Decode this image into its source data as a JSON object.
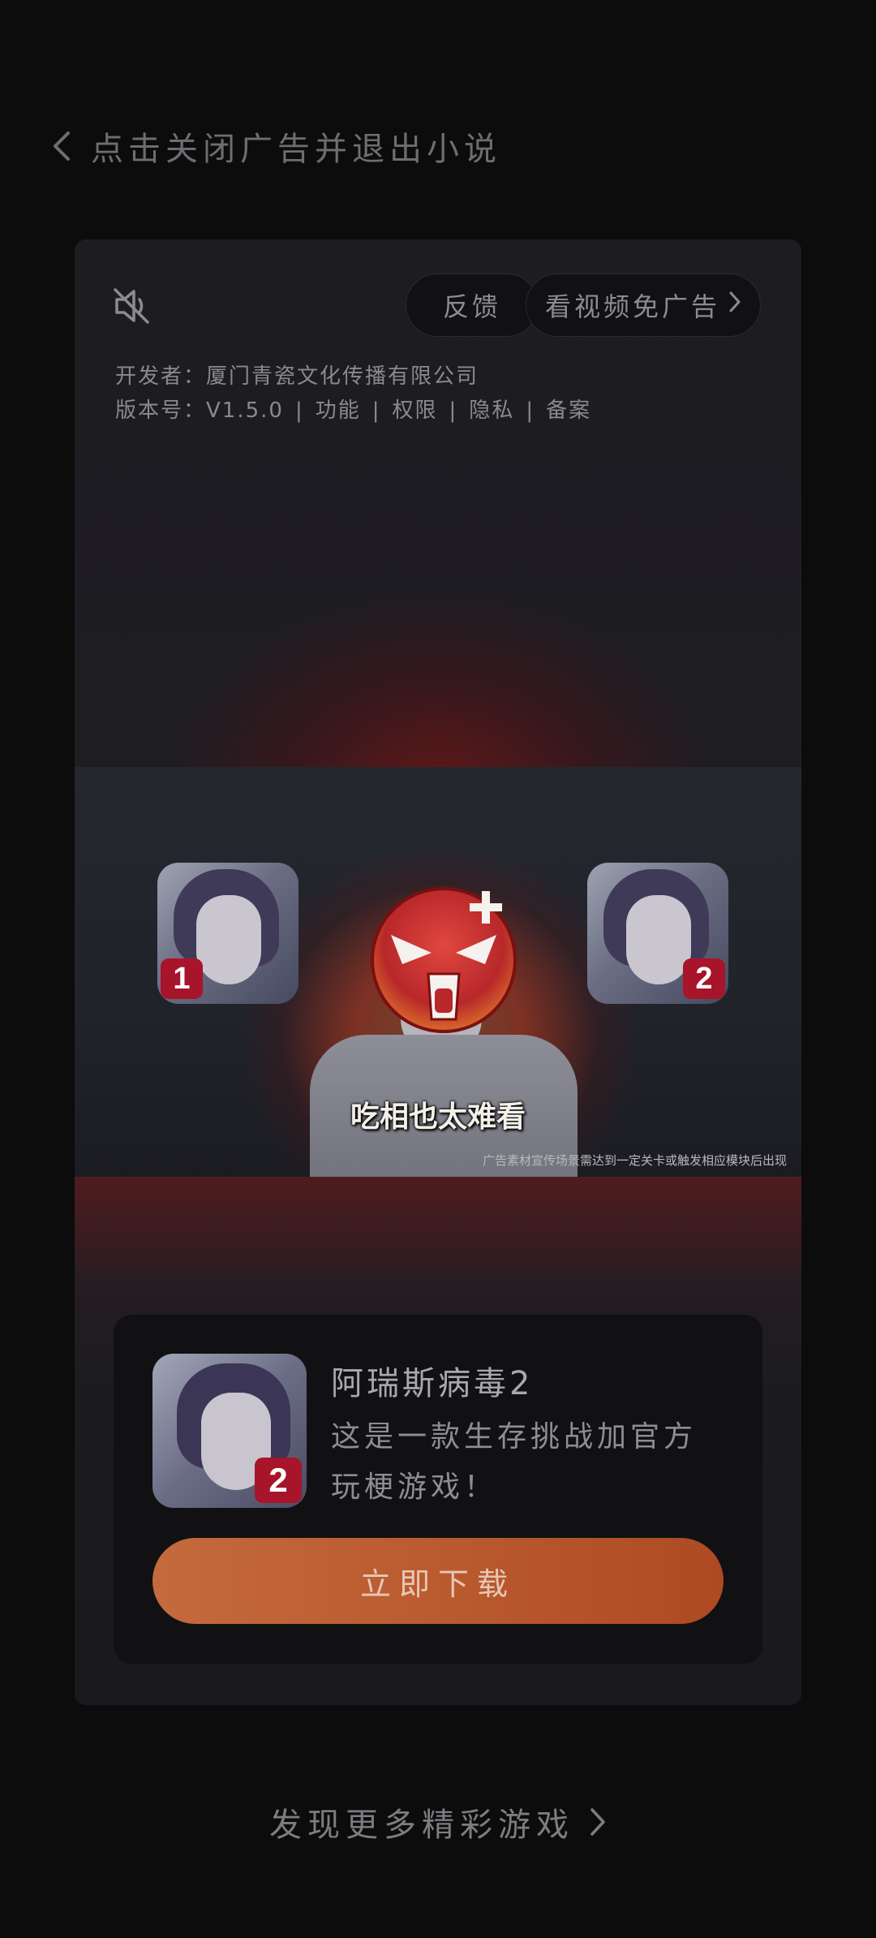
{
  "top_bar": {
    "back_icon": "chevron-left-icon",
    "close_text": "点击关闭广告并退出小说"
  },
  "ad_card": {
    "mute_icon": "speaker-muted-icon",
    "feedback_label": "反馈",
    "skip_label": "看视频免广告",
    "skip_icon": "chevron-right-icon",
    "developer_label": "开发者：",
    "developer_name": "厦门青瓷文化传播有限公司",
    "version_label": "版本号：",
    "version_value": "V1.5.0",
    "links": [
      "功能",
      "权限",
      "隐私",
      "备案"
    ],
    "separator": "|"
  },
  "video": {
    "badge_left": "1",
    "badge_right": "2",
    "subtitle": "吃相也太难看",
    "disclaimer": "广告素材宣传场景需达到一定关卡或触发相应模块后出现"
  },
  "app": {
    "name": "阿瑞斯病毒2",
    "description": "这是一款生存挑战加官方玩梗游戏！",
    "icon_badge": "2",
    "download_label": "立即下载"
  },
  "footer": {
    "more_games": "发现更多精彩游戏",
    "more_icon": "chevron-right-icon"
  },
  "colors": {
    "background": "#0c0c0d",
    "card": "#1c1c21",
    "download_button": "#b9592e",
    "badge_red": "#a8142a"
  }
}
